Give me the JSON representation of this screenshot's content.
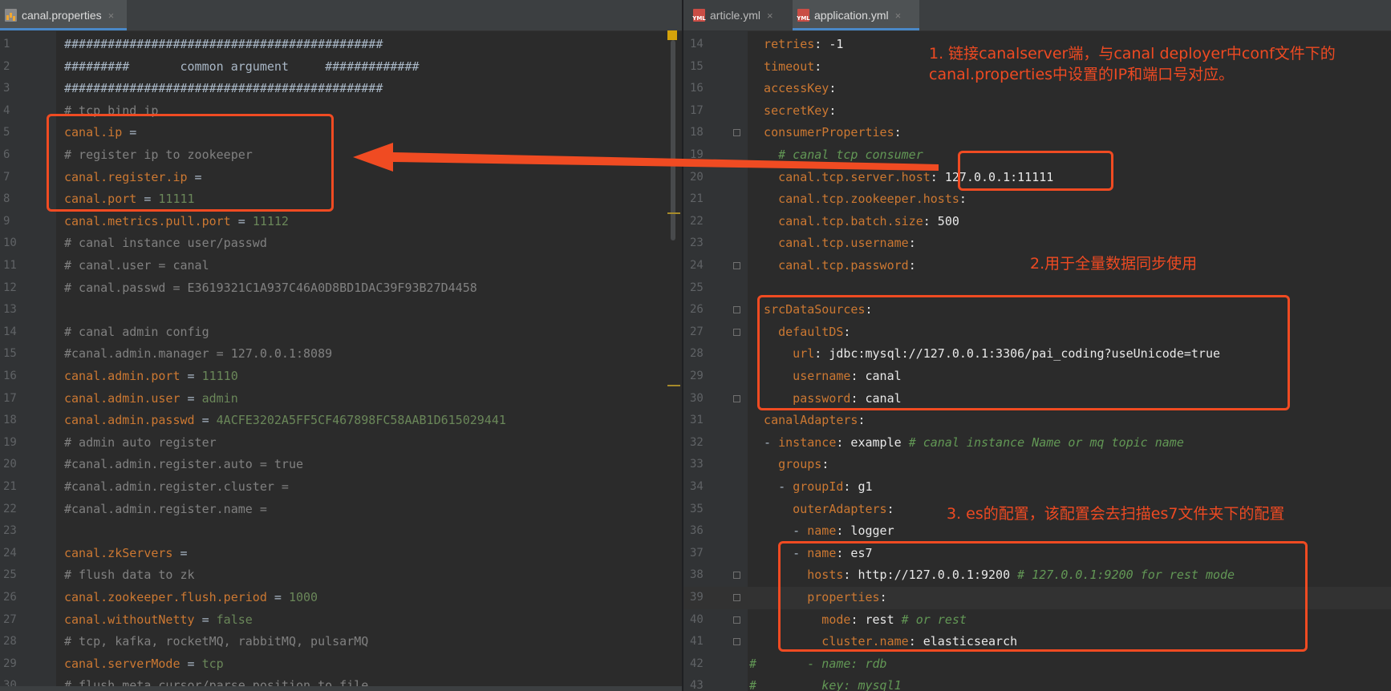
{
  "left_editor": {
    "tab": {
      "label": "canal.properties",
      "close": "×"
    },
    "lines": [
      {
        "n": "1",
        "parts": [
          [
            "c-plain",
            "############################################"
          ]
        ]
      },
      {
        "n": "2",
        "parts": [
          [
            "c-plain",
            "#########       common argument     #############"
          ]
        ]
      },
      {
        "n": "3",
        "parts": [
          [
            "c-plain",
            "############################################"
          ]
        ]
      },
      {
        "n": "4",
        "parts": [
          [
            "c-comment",
            "# tcp bind ip"
          ]
        ]
      },
      {
        "n": "5",
        "parts": [
          [
            "c-key",
            "canal.ip"
          ],
          [
            "c-plain",
            " ="
          ]
        ]
      },
      {
        "n": "6",
        "parts": [
          [
            "c-comment",
            "# register ip to zookeeper"
          ]
        ]
      },
      {
        "n": "7",
        "parts": [
          [
            "c-key",
            "canal.register.ip"
          ],
          [
            "c-plain",
            " ="
          ]
        ]
      },
      {
        "n": "8",
        "parts": [
          [
            "c-key",
            "canal.port"
          ],
          [
            "c-plain",
            " = "
          ],
          [
            "c-val",
            "11111"
          ]
        ]
      },
      {
        "n": "9",
        "parts": [
          [
            "c-key",
            "canal.metrics.pull.port"
          ],
          [
            "c-plain",
            " = "
          ],
          [
            "c-val",
            "11112"
          ]
        ]
      },
      {
        "n": "10",
        "parts": [
          [
            "c-comment",
            "# canal instance user/passwd"
          ]
        ]
      },
      {
        "n": "11",
        "parts": [
          [
            "c-comment",
            "# canal.user = canal"
          ]
        ]
      },
      {
        "n": "12",
        "parts": [
          [
            "c-comment",
            "# canal.passwd = E3619321C1A937C46A0D8BD1DAC39F93B27D4458"
          ]
        ]
      },
      {
        "n": "13",
        "parts": []
      },
      {
        "n": "14",
        "parts": [
          [
            "c-comment",
            "# canal admin config"
          ]
        ]
      },
      {
        "n": "15",
        "parts": [
          [
            "c-comment",
            "#canal.admin.manager = 127.0.0.1:8089"
          ]
        ]
      },
      {
        "n": "16",
        "parts": [
          [
            "c-key",
            "canal.admin.port"
          ],
          [
            "c-plain",
            " = "
          ],
          [
            "c-val",
            "11110"
          ]
        ]
      },
      {
        "n": "17",
        "parts": [
          [
            "c-key",
            "canal.admin.user"
          ],
          [
            "c-plain",
            " = "
          ],
          [
            "c-val",
            "admin"
          ]
        ]
      },
      {
        "n": "18",
        "parts": [
          [
            "c-key",
            "canal.admin.passwd"
          ],
          [
            "c-plain",
            " = "
          ],
          [
            "c-val",
            "4ACFE3202A5FF5CF467898FC58AAB1D615029441"
          ]
        ]
      },
      {
        "n": "19",
        "parts": [
          [
            "c-comment",
            "# admin auto register"
          ]
        ]
      },
      {
        "n": "20",
        "parts": [
          [
            "c-comment",
            "#canal.admin.register.auto = true"
          ]
        ]
      },
      {
        "n": "21",
        "parts": [
          [
            "c-comment",
            "#canal.admin.register.cluster ="
          ]
        ]
      },
      {
        "n": "22",
        "parts": [
          [
            "c-comment",
            "#canal.admin.register.name ="
          ]
        ]
      },
      {
        "n": "23",
        "parts": []
      },
      {
        "n": "24",
        "parts": [
          [
            "c-key",
            "canal.zkServers"
          ],
          [
            "c-plain",
            " ="
          ]
        ]
      },
      {
        "n": "25",
        "parts": [
          [
            "c-comment",
            "# flush data to zk"
          ]
        ]
      },
      {
        "n": "26",
        "parts": [
          [
            "c-key",
            "canal.zookeeper.flush.period"
          ],
          [
            "c-plain",
            " = "
          ],
          [
            "c-val",
            "1000"
          ]
        ]
      },
      {
        "n": "27",
        "parts": [
          [
            "c-key",
            "canal.withoutNetty"
          ],
          [
            "c-plain",
            " = "
          ],
          [
            "c-val",
            "false"
          ]
        ]
      },
      {
        "n": "28",
        "parts": [
          [
            "c-comment",
            "# tcp, kafka, rocketMQ, rabbitMQ, pulsarMQ"
          ]
        ]
      },
      {
        "n": "29",
        "parts": [
          [
            "c-key",
            "canal.serverMode"
          ],
          [
            "c-plain",
            " = "
          ],
          [
            "c-val",
            "tcp"
          ]
        ]
      },
      {
        "n": "30",
        "parts": [
          [
            "c-comment",
            "# flush meta cursor/parse position to file"
          ]
        ]
      }
    ]
  },
  "right_editor": {
    "tabs": [
      {
        "label": "article.yml",
        "close": "×",
        "icon": "YML"
      },
      {
        "label": "application.yml",
        "close": "×",
        "icon": "YML"
      }
    ],
    "lines": [
      {
        "n": "14",
        "parts": [
          [
            "c-ykey",
            "  retries"
          ],
          [
            "c-yval",
            ": -1"
          ]
        ]
      },
      {
        "n": "15",
        "parts": [
          [
            "c-ykey",
            "  timeout"
          ],
          [
            "c-yval",
            ":"
          ]
        ]
      },
      {
        "n": "16",
        "parts": [
          [
            "c-ykey",
            "  accessKey"
          ],
          [
            "c-yval",
            ":"
          ]
        ]
      },
      {
        "n": "17",
        "parts": [
          [
            "c-ykey",
            "  secretKey"
          ],
          [
            "c-yval",
            ":"
          ]
        ]
      },
      {
        "n": "18",
        "parts": [
          [
            "c-ykey",
            "  consumerProperties"
          ],
          [
            "c-yval",
            ":"
          ]
        ]
      },
      {
        "n": "19",
        "parts": [
          [
            "c-yc",
            "    # canal tcp consumer"
          ]
        ]
      },
      {
        "n": "20",
        "parts": [
          [
            "c-ykey",
            "    canal.tcp.server.host"
          ],
          [
            "c-yval",
            ": 127.0.0.1:11111"
          ]
        ]
      },
      {
        "n": "21",
        "parts": [
          [
            "c-ykey",
            "    canal.tcp.zookeeper.hosts"
          ],
          [
            "c-yval",
            ":"
          ]
        ]
      },
      {
        "n": "22",
        "parts": [
          [
            "c-ykey",
            "    canal.tcp.batch.size"
          ],
          [
            "c-yval",
            ": 500"
          ]
        ]
      },
      {
        "n": "23",
        "parts": [
          [
            "c-ykey",
            "    canal.tcp.username"
          ],
          [
            "c-yval",
            ":"
          ]
        ]
      },
      {
        "n": "24",
        "parts": [
          [
            "c-ykey",
            "    canal.tcp.password"
          ],
          [
            "c-yval",
            ":"
          ]
        ]
      },
      {
        "n": "25",
        "parts": []
      },
      {
        "n": "26",
        "parts": [
          [
            "c-ykey",
            "  srcDataSources"
          ],
          [
            "c-yval",
            ":"
          ]
        ]
      },
      {
        "n": "27",
        "parts": [
          [
            "c-ykey",
            "    defaultDS"
          ],
          [
            "c-yval",
            ":"
          ]
        ]
      },
      {
        "n": "28",
        "parts": [
          [
            "c-ykey",
            "      url"
          ],
          [
            "c-yval",
            ": jdbc:mysql://127.0.0.1:3306/pai_coding?useUnicode=true"
          ]
        ]
      },
      {
        "n": "29",
        "parts": [
          [
            "c-ykey",
            "      username"
          ],
          [
            "c-yval",
            ": canal"
          ]
        ]
      },
      {
        "n": "30",
        "parts": [
          [
            "c-ykey",
            "      password"
          ],
          [
            "c-yval",
            ": canal"
          ]
        ]
      },
      {
        "n": "31",
        "parts": [
          [
            "c-ykey",
            "  canalAdapters"
          ],
          [
            "c-yval",
            ":"
          ]
        ]
      },
      {
        "n": "32",
        "parts": [
          [
            "c-dash",
            "  - "
          ],
          [
            "c-ykey",
            "instance"
          ],
          [
            "c-yval",
            ": example "
          ],
          [
            "c-yc",
            "# canal instance Name or mq topic name"
          ]
        ]
      },
      {
        "n": "33",
        "parts": [
          [
            "c-ykey",
            "    groups"
          ],
          [
            "c-yval",
            ":"
          ]
        ]
      },
      {
        "n": "34",
        "parts": [
          [
            "c-dash",
            "    - "
          ],
          [
            "c-ykey",
            "groupId"
          ],
          [
            "c-yval",
            ": g1"
          ]
        ]
      },
      {
        "n": "35",
        "parts": [
          [
            "c-ykey",
            "      outerAdapters"
          ],
          [
            "c-yval",
            ":"
          ]
        ]
      },
      {
        "n": "36",
        "parts": [
          [
            "c-dash",
            "      - "
          ],
          [
            "c-ykey",
            "name"
          ],
          [
            "c-yval",
            ": logger"
          ]
        ]
      },
      {
        "n": "37",
        "parts": [
          [
            "c-dash",
            "      - "
          ],
          [
            "c-ykey",
            "name"
          ],
          [
            "c-yval",
            ": es7"
          ]
        ]
      },
      {
        "n": "38",
        "parts": [
          [
            "c-ykey",
            "        hosts"
          ],
          [
            "c-yval",
            ": http://127.0.0.1:9200 "
          ],
          [
            "c-yc",
            "# 127.0.0.1:9200 for rest mode"
          ]
        ]
      },
      {
        "n": "39",
        "parts": [
          [
            "c-ykey",
            "        properties"
          ],
          [
            "c-yval",
            ":"
          ]
        ]
      },
      {
        "n": "40",
        "parts": [
          [
            "c-ykey",
            "          mode"
          ],
          [
            "c-yval",
            ": rest "
          ],
          [
            "c-yc",
            "# or rest"
          ]
        ]
      },
      {
        "n": "41",
        "parts": [
          [
            "c-ykey",
            "          cluster.name"
          ],
          [
            "c-yval",
            ": elasticsearch"
          ]
        ]
      },
      {
        "n": "42",
        "parts": [
          [
            "c-hash",
            "#"
          ],
          [
            "c-yc",
            "       - name: rdb"
          ]
        ]
      },
      {
        "n": "43",
        "parts": [
          [
            "c-hash",
            "#"
          ],
          [
            "c-yc",
            "         key: mysql1"
          ]
        ]
      }
    ]
  },
  "annotations": {
    "note1_line1": "1. 链接canalserver端，与canal deployer中conf文件下的",
    "note1_line2": "canal.properties中设置的IP和端口号对应。",
    "note2": "2.用于全量数据同步使用",
    "note3": "3. es的配置，该配置会去扫描es7文件夹下的配置"
  },
  "colors": {
    "accent": "#f04b22",
    "background": "#2b2b2b",
    "key": "#cc7832",
    "value": "#6a8759"
  }
}
